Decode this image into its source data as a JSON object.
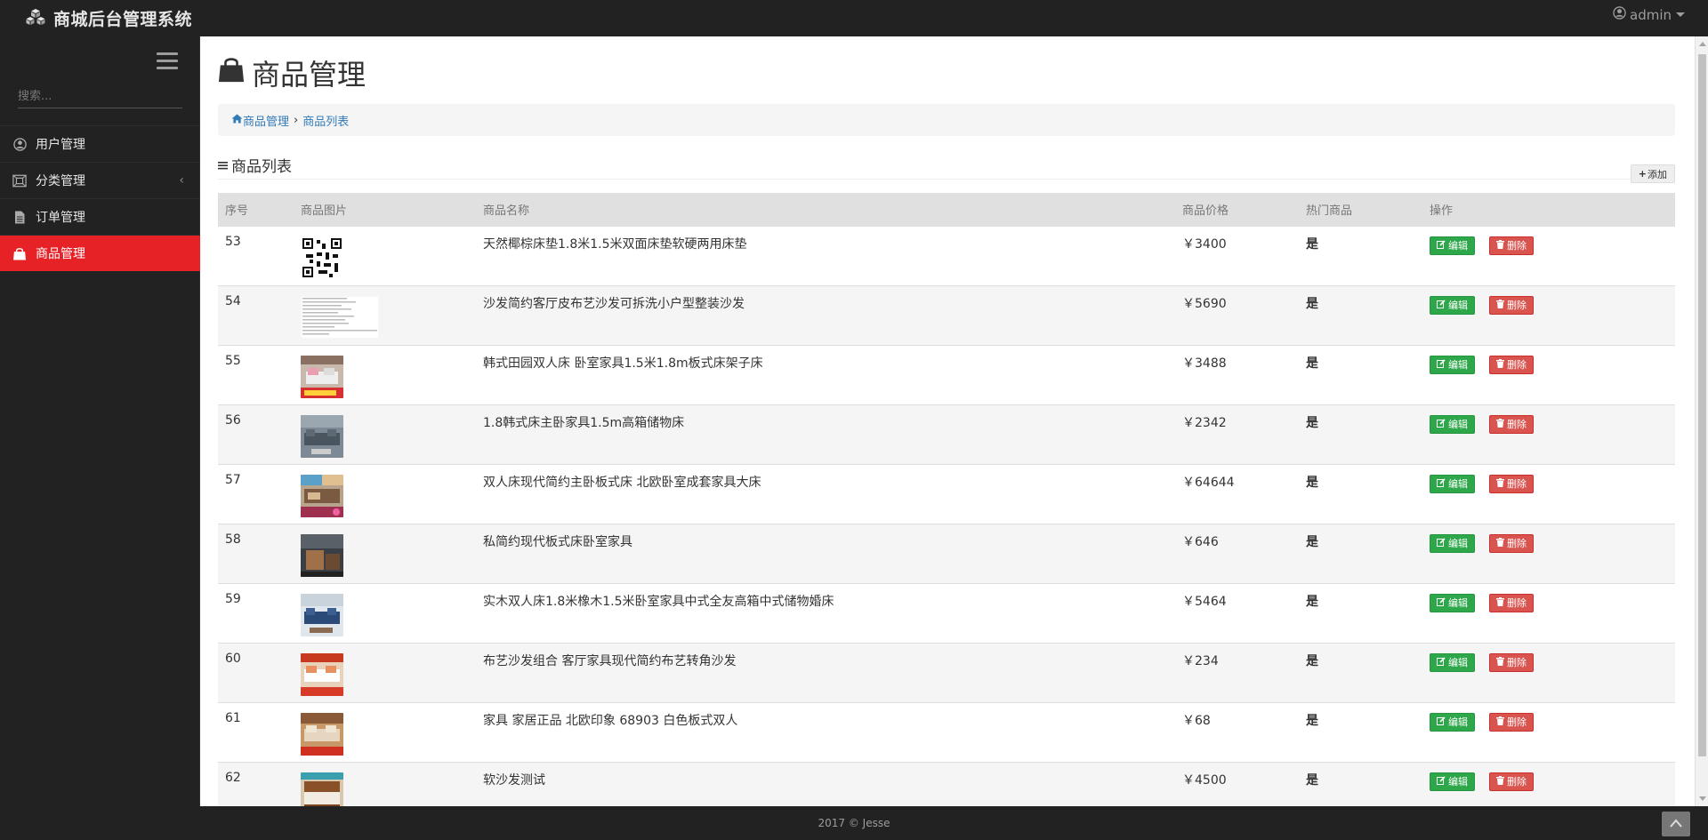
{
  "brand": {
    "title": "商城后台管理系统",
    "icon": "cubes-icon"
  },
  "user": {
    "name": "admin",
    "icon": "user-circle-icon"
  },
  "sidebar": {
    "search_placeholder": "搜索...",
    "items": [
      {
        "label": "用户管理",
        "icon": "user-icon",
        "active": false
      },
      {
        "label": "分类管理",
        "icon": "category-icon",
        "active": false,
        "arrow": "‹"
      },
      {
        "label": "订单管理",
        "icon": "document-icon",
        "active": false
      },
      {
        "label": "商品管理",
        "icon": "shopping-bag-icon",
        "active": true
      }
    ]
  },
  "page": {
    "title": "商品管理",
    "breadcrumb": {
      "home": "商品管理",
      "separator": "›",
      "current": "商品列表"
    },
    "section_title": "商品列表",
    "add_label": "添加"
  },
  "table": {
    "headers": [
      "序号",
      "商品图片",
      "商品名称",
      "商品价格",
      "热门商品",
      "操作"
    ],
    "edit_label": "编辑",
    "delete_label": "删除",
    "rows": [
      {
        "id": "53",
        "name": "天然椰棕床垫1.8米1.5米双面床垫软硬两用床垫",
        "price": "￥3400",
        "hot": "是",
        "img": "qr"
      },
      {
        "id": "54",
        "name": "沙发简约客厅皮布艺沙发可拆洗小户型整装沙发",
        "price": "￥5690",
        "hot": "是",
        "img": "doc"
      },
      {
        "id": "55",
        "name": "韩式田园双人床 卧室家具1.5米1.8m板式床架子床",
        "price": "￥3488",
        "hot": "是",
        "img": "sofa-pink"
      },
      {
        "id": "56",
        "name": "1.8韩式床主卧家具1.5m高箱储物床",
        "price": "￥2342",
        "hot": "是",
        "img": "sofa-gray"
      },
      {
        "id": "57",
        "name": "双人床现代简约主卧板式床 北欧卧室成套家具大床",
        "price": "￥64644",
        "hot": "是",
        "img": "room-multi"
      },
      {
        "id": "58",
        "name": "私简约现代板式床卧室家具",
        "price": "￥646",
        "hot": "是",
        "img": "room-dark"
      },
      {
        "id": "59",
        "name": "实木双人床1.8米橡木1.5米卧室家具中式全友高箱中式储物婚床",
        "price": "￥5464",
        "hot": "是",
        "img": "sofa-blue"
      },
      {
        "id": "60",
        "name": "布艺沙发组合 客厅家具现代简约布艺转角沙发",
        "price": "￥234",
        "hot": "是",
        "img": "sofa-red"
      },
      {
        "id": "61",
        "name": "家具 家居正品 北欧印象 68903 白色板式双人",
        "price": "￥68",
        "hot": "是",
        "img": "sofa-beige"
      },
      {
        "id": "62",
        "name": "软沙发测试",
        "price": "￥4500",
        "hot": "是",
        "img": "bed-wood"
      }
    ]
  },
  "footer": {
    "text": "2017 © Jesse"
  },
  "colors": {
    "accent": "#e62227",
    "edit": "#2ea64a",
    "delete": "#d9534f",
    "dark": "#222222"
  }
}
